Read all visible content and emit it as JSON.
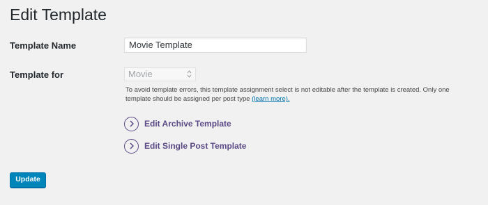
{
  "page": {
    "title": "Edit Template"
  },
  "form": {
    "template_name_label": "Template Name",
    "template_name_value": "Movie Template",
    "template_for_label": "Template for",
    "template_for_selected": "Movie",
    "template_for_disabled": true,
    "help_text": "To avoid template errors, this template assignment select is not editable after the template is created. Only one template should be assigned per post type ",
    "help_link": "(learn more)."
  },
  "actions": {
    "edit_archive": "Edit Archive Template",
    "edit_single": "Edit Single Post Template"
  },
  "buttons": {
    "update": "Update"
  },
  "colors": {
    "background": "#f1f1f1",
    "link_purple": "#5b4a86",
    "primary_button": "#0085ba",
    "help_link": "#0073aa"
  },
  "icons": {
    "action_icon": "chevron-right-circle-icon",
    "select_icon": "select-arrows-icon"
  }
}
